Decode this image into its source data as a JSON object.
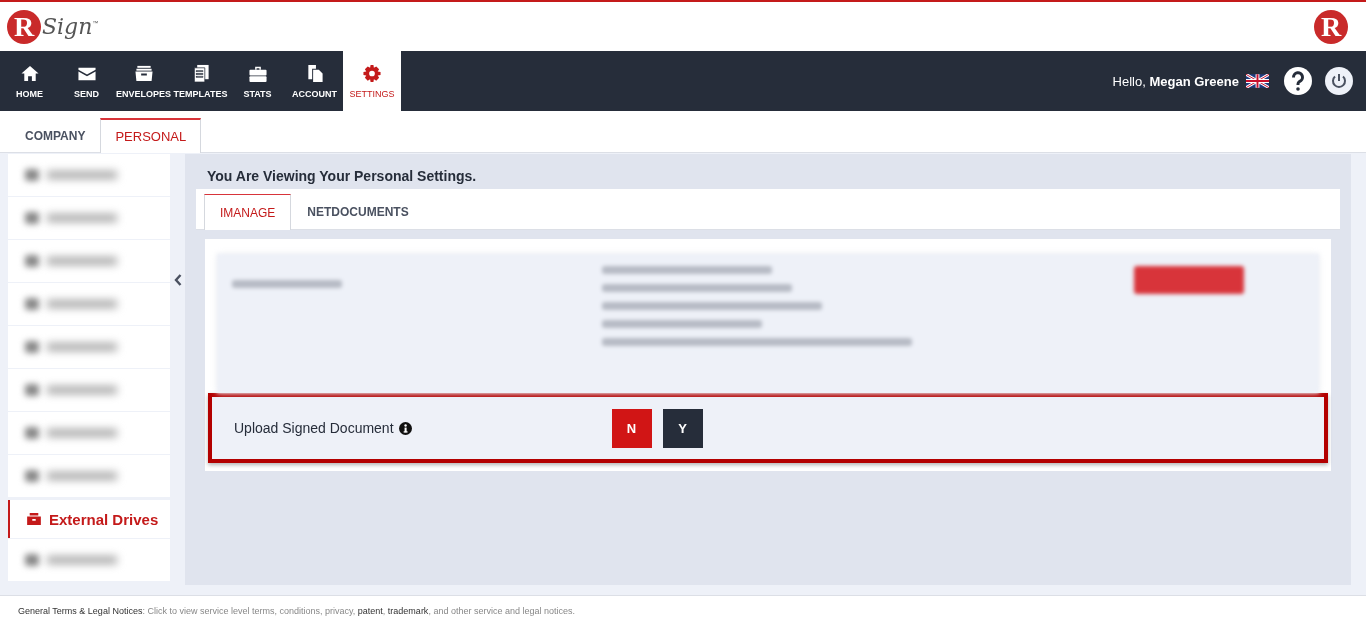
{
  "logo": {
    "mark": "R",
    "word": "Sign",
    "tm": "™"
  },
  "corner_logo": {
    "mark": "R"
  },
  "nav": [
    {
      "label": "HOME",
      "selected": false
    },
    {
      "label": "SEND",
      "selected": false
    },
    {
      "label": "ENVELOPES",
      "selected": false
    },
    {
      "label": "TEMPLATES",
      "selected": false
    },
    {
      "label": "STATS",
      "selected": false
    },
    {
      "label": "ACCOUNT",
      "selected": false
    },
    {
      "label": "SETTINGS",
      "selected": true
    }
  ],
  "user": {
    "greeting": "Hello,",
    "name": "Megan Greene"
  },
  "scope_tabs": [
    {
      "label": "COMPANY",
      "selected": false
    },
    {
      "label": "PERSONAL",
      "selected": true
    }
  ],
  "sidebar": {
    "items": [
      {
        "kind": "blurred",
        "selected": false
      },
      {
        "kind": "blurred",
        "selected": false
      },
      {
        "kind": "blurred",
        "selected": false
      },
      {
        "kind": "blurred",
        "selected": false
      },
      {
        "kind": "blurred",
        "selected": false
      },
      {
        "kind": "blurred",
        "selected": false
      },
      {
        "kind": "blurred",
        "selected": false
      },
      {
        "kind": "blurred",
        "selected": false
      },
      {
        "kind": "label",
        "label": "External Drives",
        "selected": true
      },
      {
        "kind": "blurred",
        "selected": false
      }
    ]
  },
  "heading": "You Are Viewing Your Personal Settings.",
  "drive_tabs": [
    {
      "label": "IMANAGE",
      "selected": true
    },
    {
      "label": "NETDOCUMENTS",
      "selected": false
    }
  ],
  "upload_setting": {
    "label": "Upload Signed Document",
    "highlighted": true,
    "options": [
      {
        "label": "N",
        "selected": true
      },
      {
        "label": "Y",
        "selected": false
      }
    ]
  },
  "footer": [
    {
      "kind": "title",
      "text": "General Terms & Legal Notices"
    },
    {
      "kind": "text",
      "text": ": Click to view service level terms, conditions, privacy, "
    },
    {
      "kind": "link",
      "text": "patent"
    },
    {
      "kind": "text",
      "text": ", "
    },
    {
      "kind": "link",
      "text": "trademark"
    },
    {
      "kind": "text",
      "text": ", and other service and legal notices."
    }
  ]
}
